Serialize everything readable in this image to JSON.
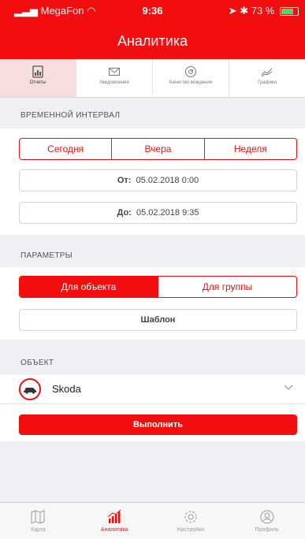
{
  "status_bar": {
    "carrier": "MegaFon",
    "time": "9:36",
    "battery": "73 %",
    "battery_level": 0.73
  },
  "header": {
    "title": "Аналитика"
  },
  "tabs": [
    {
      "label": "Отчеты",
      "icon": "report-icon",
      "active": true
    },
    {
      "label": "Уведомления",
      "icon": "envelope-icon",
      "active": false
    },
    {
      "label": "Качество вождения",
      "icon": "speedometer-icon",
      "active": false
    },
    {
      "label": "Графики",
      "icon": "chart-line-icon",
      "active": false
    }
  ],
  "interval": {
    "section_title": "ВРЕМЕННОЙ ИНТЕРВАЛ",
    "options": [
      "Сегодня",
      "Вчера",
      "Неделя"
    ],
    "from_label": "От:",
    "from_value": "05.02.2018 0:00",
    "to_label": "До:",
    "to_value": "05.02.2018 9:35"
  },
  "params": {
    "section_title": "ПАРАМЕТРЫ",
    "options": [
      "Для объекта",
      "Для группы"
    ],
    "selected": "Для объекта",
    "template_label": "Шаблон"
  },
  "object": {
    "section_title": "ОБЪЕКТ",
    "name": "Skoda",
    "run_label": "Выполнить"
  },
  "tabbar": [
    {
      "label": "Карта",
      "icon": "map-icon",
      "active": false
    },
    {
      "label": "Аналитика",
      "icon": "analytics-icon",
      "active": true
    },
    {
      "label": "Настройки",
      "icon": "gear-icon",
      "active": false
    },
    {
      "label": "Профиль",
      "icon": "profile-icon",
      "active": false
    }
  ],
  "colors": {
    "accent": "#f20e0e",
    "background": "#efeff4"
  }
}
